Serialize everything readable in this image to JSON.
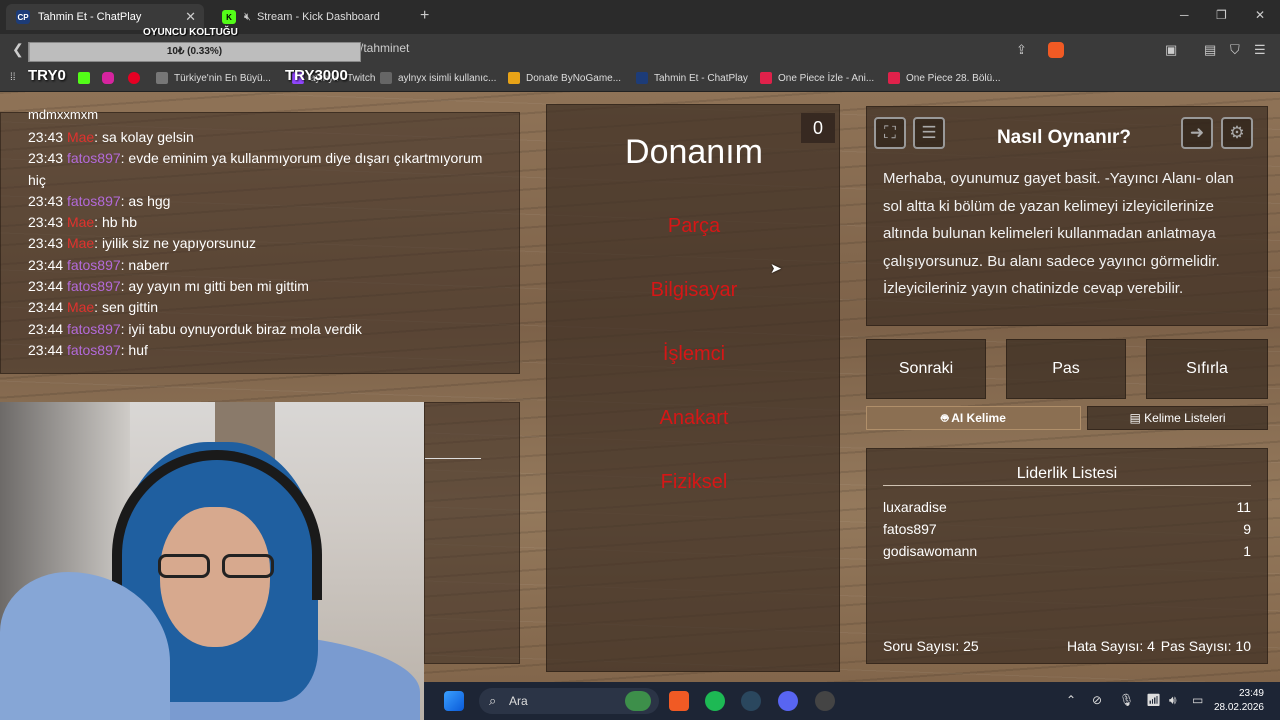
{
  "browser": {
    "tabs": [
      {
        "label": "Tahmin Et - ChatPlay",
        "favicon": "CP",
        "active": true
      },
      {
        "label": "Stream - Kick Dashboard",
        "favicon": "K",
        "active": false
      }
    ],
    "url": "/tahminet",
    "bookmarks": [
      {
        "label": "Türkiye'nin En Büyü..."
      },
      {
        "label": "aylnyx - Twitch"
      },
      {
        "label": "aylnyx isimli kullanıc..."
      },
      {
        "label": "Donate ByNoGame..."
      },
      {
        "label": "Tahmin Et - ChatPlay"
      },
      {
        "label": "One Piece İzle - Ani..."
      },
      {
        "label": "One Piece 28. Bölü..."
      }
    ]
  },
  "stream_overlay": {
    "title": "OYUNCU KOLTUĞU",
    "progress_text": "10₺ (0.33%)",
    "progress_fraction": 0.0033,
    "left_label": "TRY0",
    "right_label": "TRY3000"
  },
  "chat": {
    "partial_line": "mdmxxmxm",
    "messages": [
      {
        "time": "23:43",
        "user": "Mae",
        "user_color": "red",
        "text": ": sa kolay gelsin"
      },
      {
        "time": "23:43",
        "user": "fatos897",
        "user_color": "purple",
        "text": ": evde eminim ya kullanmıyorum diye dışarı çıkartmıyorum hiç"
      },
      {
        "time": "23:43",
        "user": "fatos897",
        "user_color": "purple",
        "text": ": as hgg"
      },
      {
        "time": "23:43",
        "user": "Mae",
        "user_color": "red",
        "text": ": hb hb"
      },
      {
        "time": "23:43",
        "user": "Mae",
        "user_color": "red",
        "text": ": iyilik siz ne yapıyorsunuz"
      },
      {
        "time": "23:44",
        "user": "fatos897",
        "user_color": "purple",
        "text": ": naberr"
      },
      {
        "time": "23:44",
        "user": "fatos897",
        "user_color": "purple",
        "text": ": ay yayın mı gitti ben mi gittim"
      },
      {
        "time": "23:44",
        "user": "Mae",
        "user_color": "red",
        "text": ": sen gittin"
      },
      {
        "time": "23:44",
        "user": "fatos897",
        "user_color": "purple",
        "text": ": iyii tabu oynuyorduk biraz mola verdik"
      },
      {
        "time": "23:44",
        "user": "fatos897",
        "user_color": "purple",
        "text": ": huf"
      }
    ]
  },
  "card": {
    "score": "0",
    "word": "Donanım",
    "forbidden": [
      "Parça",
      "Bilgisayar",
      "İşlemci",
      "Anakart",
      "Fiziksel"
    ]
  },
  "howto": {
    "title": "Nasıl Oynanır?",
    "text": "Merhaba, oyunumuz gayet basit. -Yayıncı Alanı- olan sol altta ki bölüm de yazan kelimeyi izleyicilerinize altında bulunan kelimeleri kullanmadan anlatmaya çalışıyorsunuz. Bu alanı sadece yayıncı görmelidir. İzleyicileriniz yayın chatinizde cevap verebilir."
  },
  "actions": {
    "next": "Sonraki",
    "pass": "Pas",
    "reset": "Sıfırla",
    "ai_word": "AI Kelime",
    "word_lists": "Kelime Listeleri"
  },
  "leaderboard": {
    "title": "Liderlik Listesi",
    "rows": [
      {
        "name": "luxaradise",
        "score": "11"
      },
      {
        "name": "fatos897",
        "score": "9"
      },
      {
        "name": "godisawomann",
        "score": "1"
      }
    ],
    "questions": "Soru Sayısı: 25",
    "errors": "Hata Sayısı: 4",
    "passes": "Pas Sayısı: 10"
  },
  "taskbar": {
    "search_placeholder": "Ara",
    "time": "23:49",
    "date": "28.02.2026"
  },
  "colors": {
    "forbidden_red": "#d61616",
    "user_purple": "#b36ad9",
    "user_red": "#e0322e"
  }
}
